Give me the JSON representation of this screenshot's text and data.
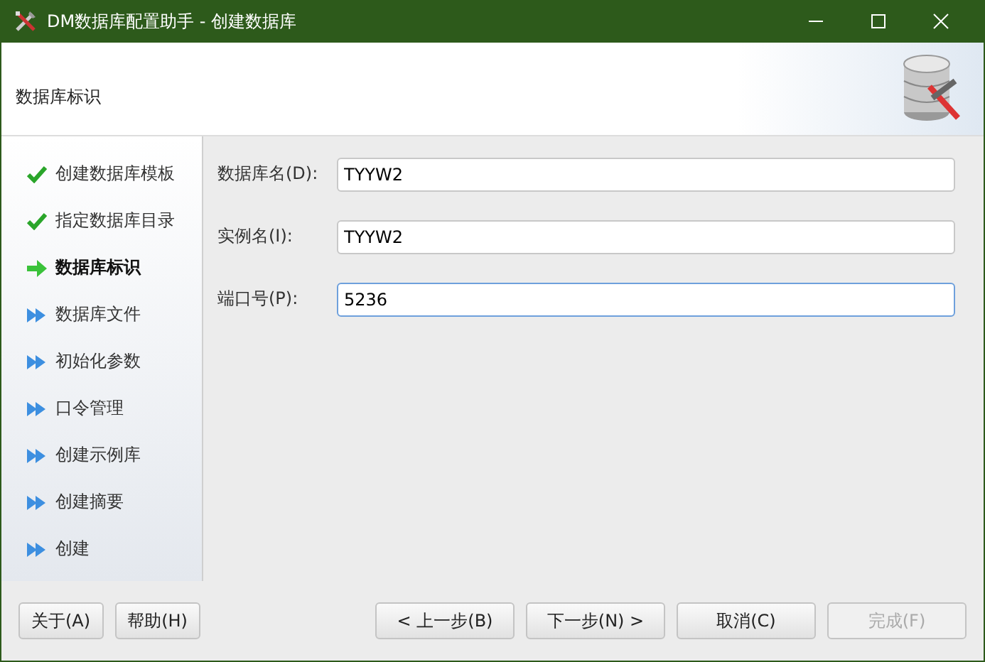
{
  "window": {
    "title": "DM数据库配置助手 - 创建数据库"
  },
  "header": {
    "title": "数据库标识"
  },
  "steps": [
    {
      "label": "创建数据库模板",
      "kind": "done"
    },
    {
      "label": "指定数据库目录",
      "kind": "done"
    },
    {
      "label": "数据库标识",
      "kind": "current"
    },
    {
      "label": "数据库文件",
      "kind": "pending"
    },
    {
      "label": "初始化参数",
      "kind": "pending"
    },
    {
      "label": "口令管理",
      "kind": "pending"
    },
    {
      "label": "创建示例库",
      "kind": "pending"
    },
    {
      "label": "创建摘要",
      "kind": "pending"
    },
    {
      "label": "创建",
      "kind": "pending"
    }
  ],
  "fields": [
    {
      "label": "数据库名(D):",
      "value": "TYYW2",
      "focused": false
    },
    {
      "label": "实例名(I):",
      "value": "TYYW2",
      "focused": false
    },
    {
      "label": "端口号(P):",
      "value": "5236",
      "focused": true
    }
  ],
  "left_buttons": [
    {
      "label": "关于(A)",
      "disabled": false
    },
    {
      "label": "帮助(H)",
      "disabled": false
    }
  ],
  "right_buttons": [
    {
      "label": "< 上一步(B)",
      "disabled": false
    },
    {
      "label": "下一步(N) >",
      "disabled": false
    },
    {
      "label": "取消(C)",
      "disabled": false
    },
    {
      "label": "完成(F)",
      "disabled": true
    }
  ]
}
